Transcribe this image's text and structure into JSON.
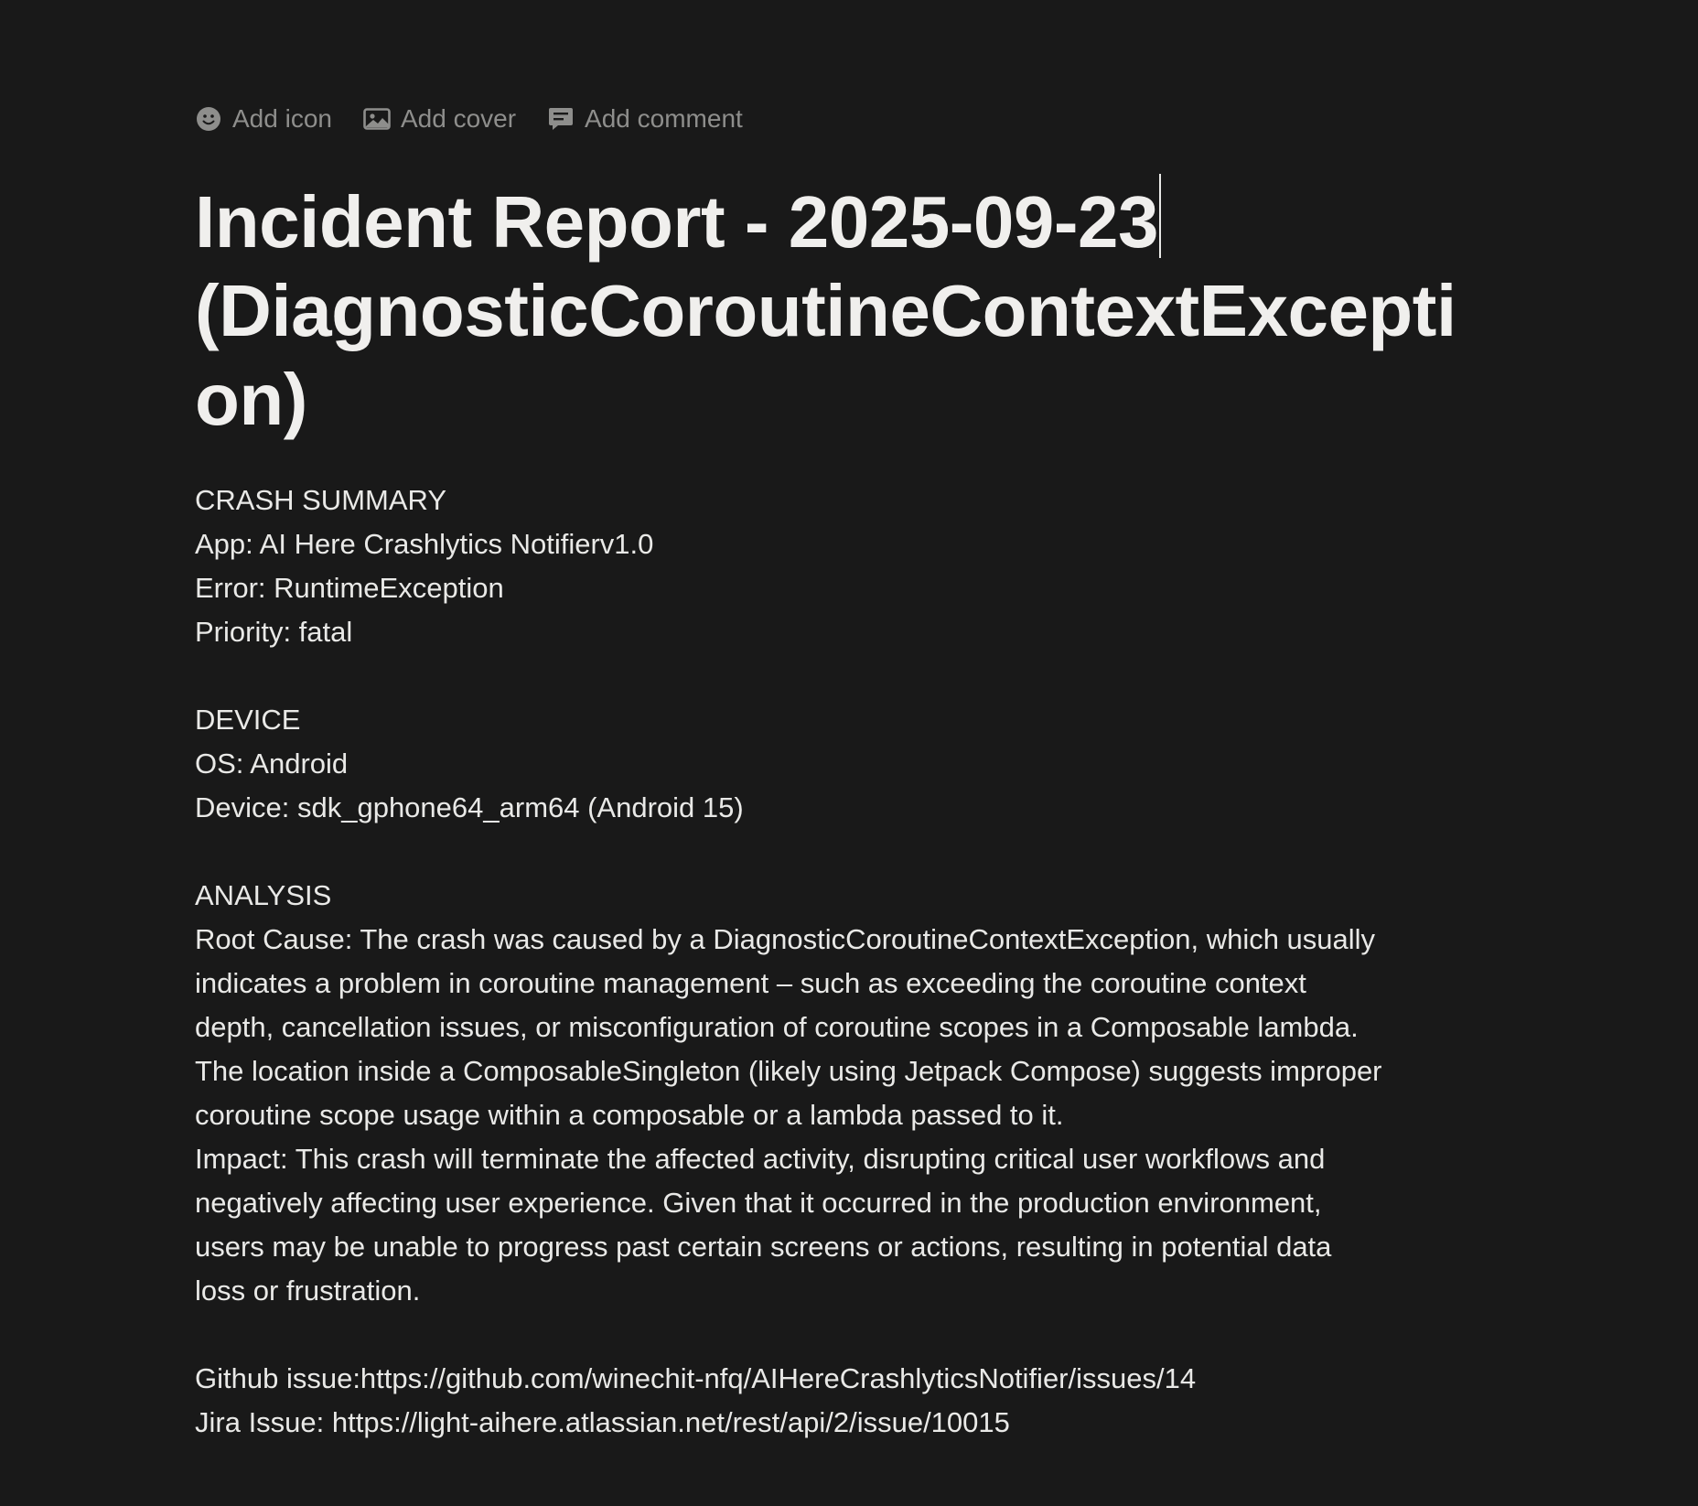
{
  "page_controls": {
    "add_icon": "Add icon",
    "add_cover": "Add cover",
    "add_comment": "Add comment",
    "icons": [
      "smiley-icon",
      "image-icon",
      "comment-icon"
    ]
  },
  "title": {
    "line1": "Incident Report - 2025-09-23",
    "line2": "(DiagnosticCoroutineContextExcepti",
    "line3": "on)"
  },
  "crash_summary": {
    "heading": "CRASH SUMMARY",
    "app": "App: AI Here Crashlytics Notifierv1.0",
    "error": "Error: RuntimeException",
    "priority": "Priority: fatal"
  },
  "device": {
    "heading": "DEVICE",
    "os": "OS: Android",
    "device": "Device: sdk_gphone64_arm64 (Android 15)"
  },
  "analysis": {
    "heading": "ANALYSIS",
    "lines": [
      "Root Cause: The crash was caused by a DiagnosticCoroutineContextException, which usually",
      "indicates a problem in coroutine management – such as exceeding the coroutine context",
      "depth, cancellation issues, or misconfiguration of coroutine scopes in a Composable lambda.",
      "The location inside a ComposableSingleton (likely using Jetpack Compose) suggests improper",
      "coroutine scope usage within a composable or a lambda passed to it.",
      "Impact: This crash will terminate the affected activity, disrupting critical user workflows and",
      "negatively affecting user experience. Given that it occurred in the production environment,",
      "users may be unable to progress past certain screens or actions, resulting in potential data",
      "loss or frustration."
    ]
  },
  "links": {
    "github": "Github issue:https://github.com/winechit-nfq/AIHereCrashlyticsNotifier/issues/14",
    "jira": "Jira Issue: https://light-aihere.atlassian.net/rest/api/2/issue/10015"
  }
}
